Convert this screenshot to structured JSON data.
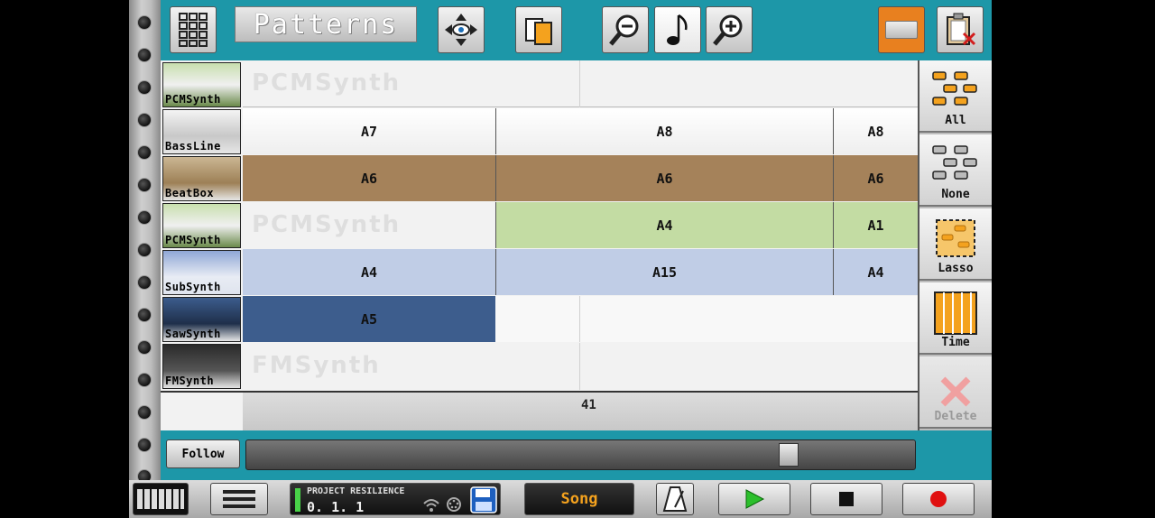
{
  "toolbar": {
    "title": "Patterns",
    "grid_icon": "grid-icon",
    "move_icon": "move-arrows-icon",
    "copy_icon": "copy-pages-icon",
    "zoom_out_icon": "zoom-out-icon",
    "note_icon": "music-note-icon",
    "zoom_in_icon": "zoom-in-icon",
    "color_icon": "color-swatch-icon",
    "paste_delete_icon": "clipboard-delete-icon"
  },
  "tracks": [
    {
      "name": "PCMSynth",
      "ghost": "PCMSynth",
      "color": "#9ecb6e"
    },
    {
      "name": "BassLine",
      "ghost": "",
      "color": "#cfcfcf"
    },
    {
      "name": "BeatBox",
      "ghost": "",
      "color": "#a5825a"
    },
    {
      "name": "PCMSynth",
      "ghost": "PCMSynth",
      "color": "#9ecb6e"
    },
    {
      "name": "SubSynth",
      "ghost": "",
      "color": "#9eb0d4"
    },
    {
      "name": "SawSynth",
      "ghost": "",
      "color": "#3d5d8d"
    },
    {
      "name": "FMSynth",
      "ghost": "FMSynth",
      "color": "#555555"
    }
  ],
  "clips": {
    "bassline": [
      "A7",
      "A8",
      "A8"
    ],
    "beatbox": [
      "A6",
      "A6",
      "A6"
    ],
    "pcmsynth2": [
      "A4",
      "A1"
    ],
    "subsynth": [
      "A4",
      "A15",
      "A4"
    ],
    "sawsynth": [
      "A5"
    ]
  },
  "ruler": {
    "bar": "41"
  },
  "side": {
    "all": "All",
    "none": "None",
    "lasso": "Lasso",
    "time": "Time",
    "delete": "Delete"
  },
  "scroll": {
    "follow": "Follow",
    "position": 0.82
  },
  "bottom": {
    "project_name": "Project Resilience",
    "position": "0. 1. 1",
    "mode": "Song",
    "keyboard_icon": "keyboard-icon",
    "menu_icon": "menu-icon",
    "wifi_icon": "wifi-icon",
    "midi_icon": "midi-icon",
    "save_icon": "save-disk-icon",
    "metronome_icon": "metronome-icon",
    "play_icon": "play-icon",
    "stop_icon": "stop-icon",
    "record_icon": "record-icon"
  }
}
